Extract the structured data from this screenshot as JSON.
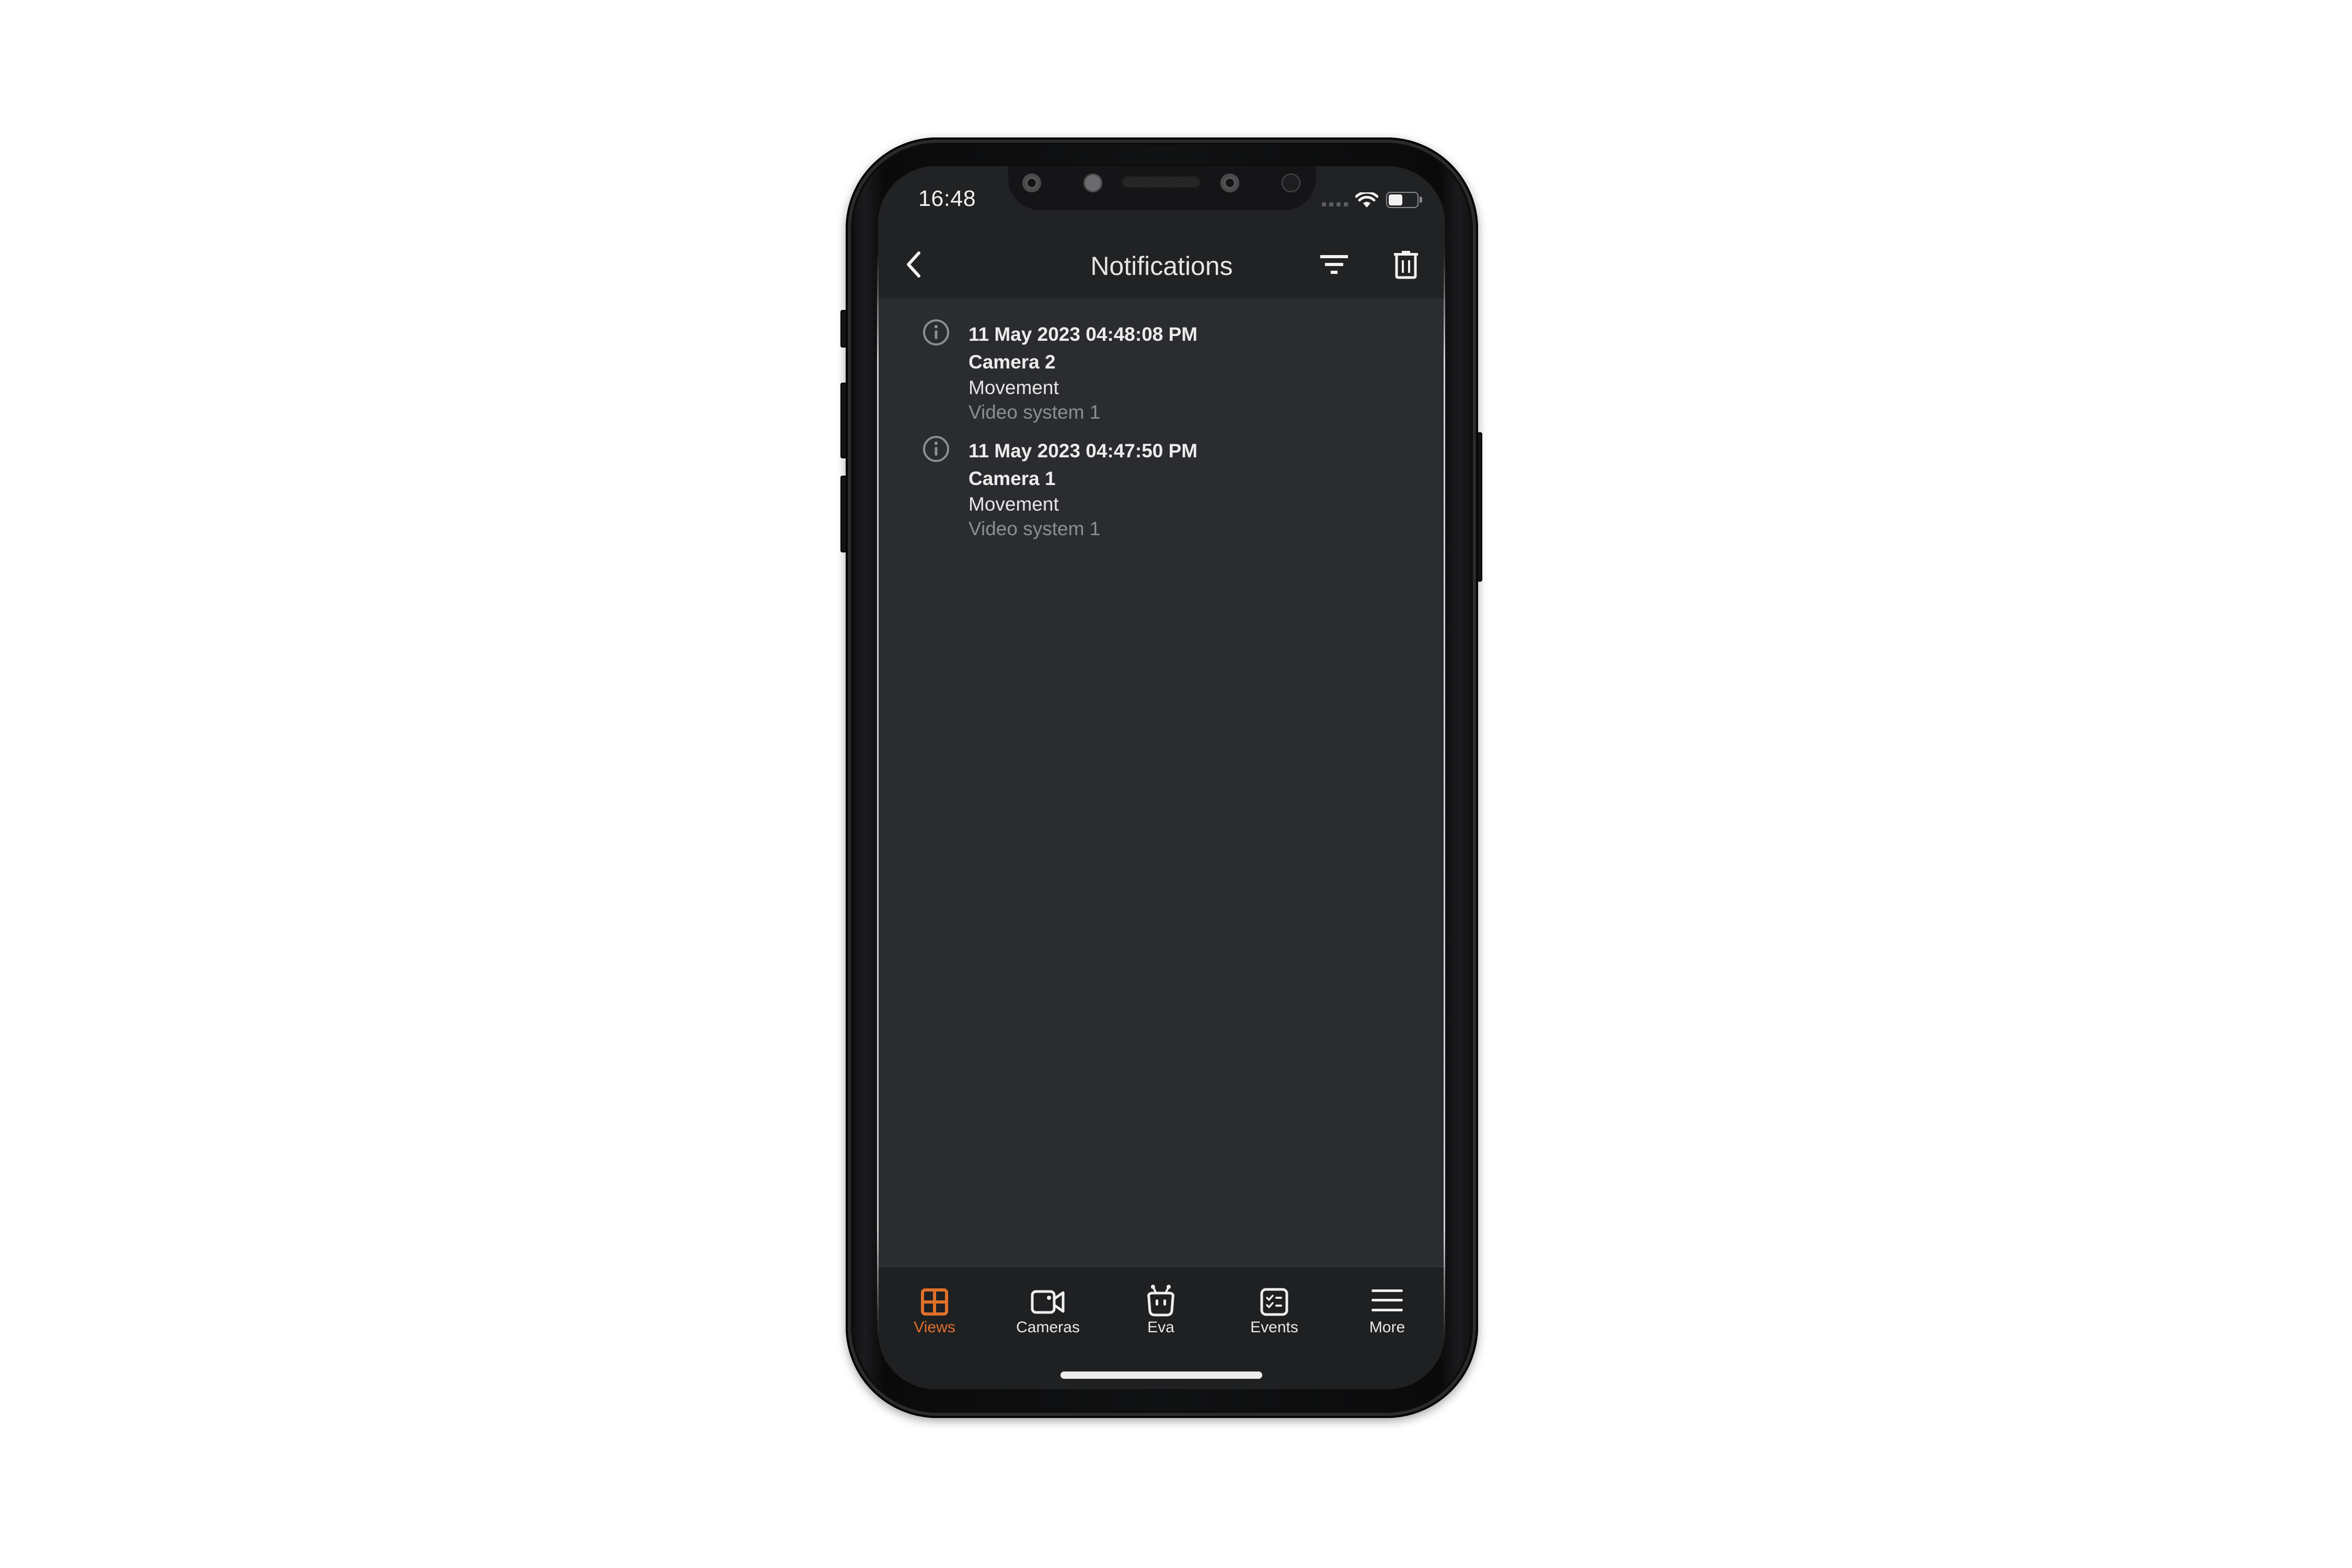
{
  "status_bar": {
    "time": "16:48",
    "signal_icon": "signal-dots-icon",
    "wifi_icon": "wifi-icon",
    "battery_icon": "battery-icon",
    "battery_level": 0.5
  },
  "header": {
    "title": "Notifications",
    "back_icon": "chevron-left-icon",
    "filter_icon": "filter-icon",
    "delete_icon": "trash-icon"
  },
  "notifications": [
    {
      "icon": "info-icon",
      "timestamp": "11 May 2023 04:48:08 PM",
      "camera": "Camera 2",
      "event": "Movement",
      "system": "Video system 1"
    },
    {
      "icon": "info-icon",
      "timestamp": "11 May 2023 04:47:50 PM",
      "camera": "Camera 1",
      "event": "Movement",
      "system": "Video system 1"
    }
  ],
  "tabs": [
    {
      "label": "Views",
      "icon": "grid-icon",
      "active": true
    },
    {
      "label": "Cameras",
      "icon": "video-camera-icon",
      "active": false
    },
    {
      "label": "Eva",
      "icon": "robot-icon",
      "active": false
    },
    {
      "label": "Events",
      "icon": "checklist-icon",
      "active": false
    },
    {
      "label": "More",
      "icon": "hamburger-menu-icon",
      "active": false
    }
  ],
  "colors": {
    "accent": "#e0702a",
    "background": "#2a2c2f",
    "header_background": "#212224",
    "text_primary": "#ececec",
    "text_secondary": "#8b8e95"
  }
}
